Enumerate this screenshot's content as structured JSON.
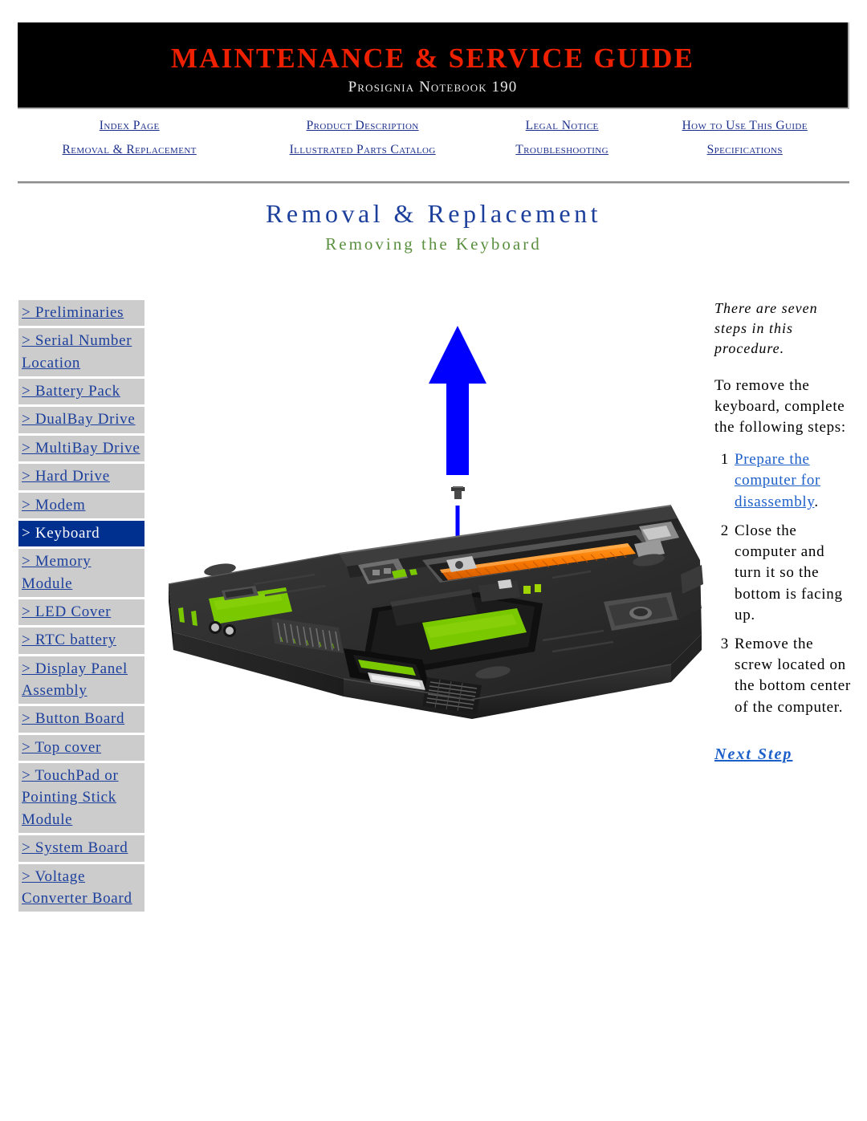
{
  "header": {
    "title": "MAINTENANCE & SERVICE GUIDE",
    "subtitle": "Prosignia Notebook 190",
    "title_color": "#ee2000",
    "background_color": "#000000"
  },
  "nav": {
    "row1": [
      {
        "label": "Index Page",
        "name": "index-page"
      },
      {
        "label": "Product Description",
        "name": "product-description"
      },
      {
        "label": "Legal Notice",
        "name": "legal-notice"
      },
      {
        "label": "How to Use This Guide",
        "name": "how-to-use-this-guide"
      }
    ],
    "row2": [
      {
        "label": "Removal & Replacement",
        "name": "removal-replacement"
      },
      {
        "label": "Illustrated Parts Catalog",
        "name": "illustrated-parts-catalog"
      },
      {
        "label": "Troubleshooting",
        "name": "troubleshooting"
      },
      {
        "label": "Specifications",
        "name": "specifications"
      }
    ],
    "link_color": "#1c2f8c"
  },
  "page": {
    "title": "Removal & Replacement",
    "subtitle": "Removing the Keyboard",
    "title_color": "#1c3f9c",
    "subtitle_color": "#5b9040"
  },
  "sidebar": {
    "background_color": "#cccccc",
    "highlight_color": "#00308f",
    "link_color": "#1c3f9c",
    "items": [
      {
        "label": "> Preliminaries",
        "current": false
      },
      {
        "label": "> Serial Number Location",
        "current": false
      },
      {
        "label": "> Battery Pack",
        "current": false
      },
      {
        "label": "> DualBay Drive",
        "current": false
      },
      {
        "label": "> MultiBay Drive",
        "current": false
      },
      {
        "label": "> Hard Drive",
        "current": false
      },
      {
        "label": "> Modem",
        "current": false
      },
      {
        "label": "> Keyboard",
        "current": true
      },
      {
        "label": "> Memory Module",
        "current": false
      },
      {
        "label": "> LED Cover",
        "current": false
      },
      {
        "label": "> RTC battery",
        "current": false
      },
      {
        "label": "> Display Panel Assembly",
        "current": false
      },
      {
        "label": "> Button Board",
        "current": false
      },
      {
        "label": "> Top cover",
        "current": false
      },
      {
        "label": "> TouchPad or Pointing Stick Module",
        "current": false
      },
      {
        "label": "> System Board",
        "current": false
      },
      {
        "label": "> Voltage Converter Board",
        "current": false
      }
    ]
  },
  "illustration": {
    "name": "notebook-bottom-screw-removal-diagram",
    "arrow_color": "#0000ff",
    "chassis_color": "#2b2b2b",
    "pcb_color": "#7ac800",
    "connector_color": "#ff7a00"
  },
  "instructions": {
    "note": "There are seven steps in this procedure.",
    "lead_in": "To remove the keyboard, complete the following steps:",
    "steps": [
      {
        "number": "1",
        "link_text": "Prepare the computer for disassembly",
        "trailing_text": "."
      },
      {
        "number": "2",
        "text": "Close the computer and turn it so the bottom is facing up."
      },
      {
        "number": "3",
        "text": "Remove the screw located on the bottom center of the computer."
      }
    ],
    "next_step_label": "Next Step",
    "link_color": "#1c5fc9"
  }
}
